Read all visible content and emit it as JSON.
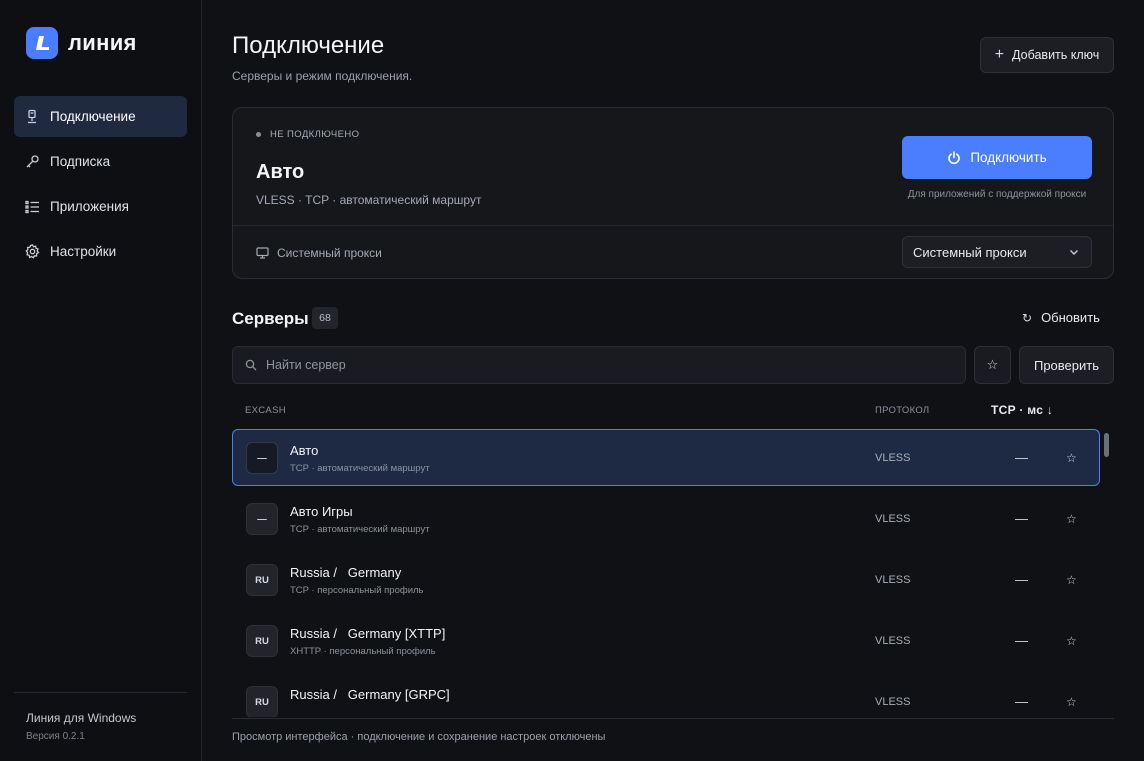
{
  "brand": {
    "name": "линия",
    "accent": "#4a7dff"
  },
  "sidebar": {
    "items": [
      {
        "label": "Подключение",
        "icon": "plug-icon",
        "active": true
      },
      {
        "label": "Подписка",
        "icon": "key-icon",
        "active": false
      },
      {
        "label": "Приложения",
        "icon": "list-icon",
        "active": false
      },
      {
        "label": "Настройки",
        "icon": "gear-icon",
        "active": false
      }
    ],
    "footer_title": "Линия для Windows",
    "footer_version": "Версия 0.2.1"
  },
  "header": {
    "title": "Подключение",
    "subtitle": "Серверы и режим подключения.",
    "add_key_label": "Добавить ключ"
  },
  "connection": {
    "status": "НЕ ПОДКЛЮЧЕНО",
    "name": "Авто",
    "meta": "VLESS · TCP · автоматический маршрут",
    "connect_label": "Подключить",
    "connect_hint": "Для приложений с поддержкой прокси",
    "proxy_label": "Системный прокси",
    "proxy_mode": "Системный прокси"
  },
  "servers": {
    "title": "Серверы",
    "count": "68",
    "refresh_label": "Обновить",
    "search_placeholder": "Найти сервер",
    "fav_symbol": "☆",
    "check_label": "Проверить",
    "columns": {
      "group": "EXCASH",
      "protocol": "ПРОТОКОЛ",
      "ping": "TCP · мс ↓"
    },
    "rows": [
      {
        "badge": "—",
        "name": "Авто",
        "sub": "TCP · автоматический маршрут",
        "protocol": "VLESS",
        "ping": "—",
        "star": "☆",
        "selected": true
      },
      {
        "badge": "—",
        "name": "Авто Игры",
        "sub": "TCP · автоматический маршрут",
        "protocol": "VLESS",
        "ping": "—",
        "star": "☆",
        "selected": false
      },
      {
        "badge": "RU",
        "name": "Russia /   Germany",
        "sub": "TCP · персональный профиль",
        "protocol": "VLESS",
        "ping": "—",
        "star": "☆",
        "selected": false
      },
      {
        "badge": "RU",
        "name": "Russia /   Germany [XTTP]",
        "sub": "XHTTP · персональный профиль",
        "protocol": "VLESS",
        "ping": "—",
        "star": "☆",
        "selected": false
      },
      {
        "badge": "RU",
        "name": "Russia /   Germany [GRPC]",
        "sub": "",
        "protocol": "VLESS",
        "ping": "—",
        "star": "☆",
        "selected": false
      }
    ]
  },
  "footer_note": "Просмотр интерфейса · подключение и сохранение настроек отключены"
}
